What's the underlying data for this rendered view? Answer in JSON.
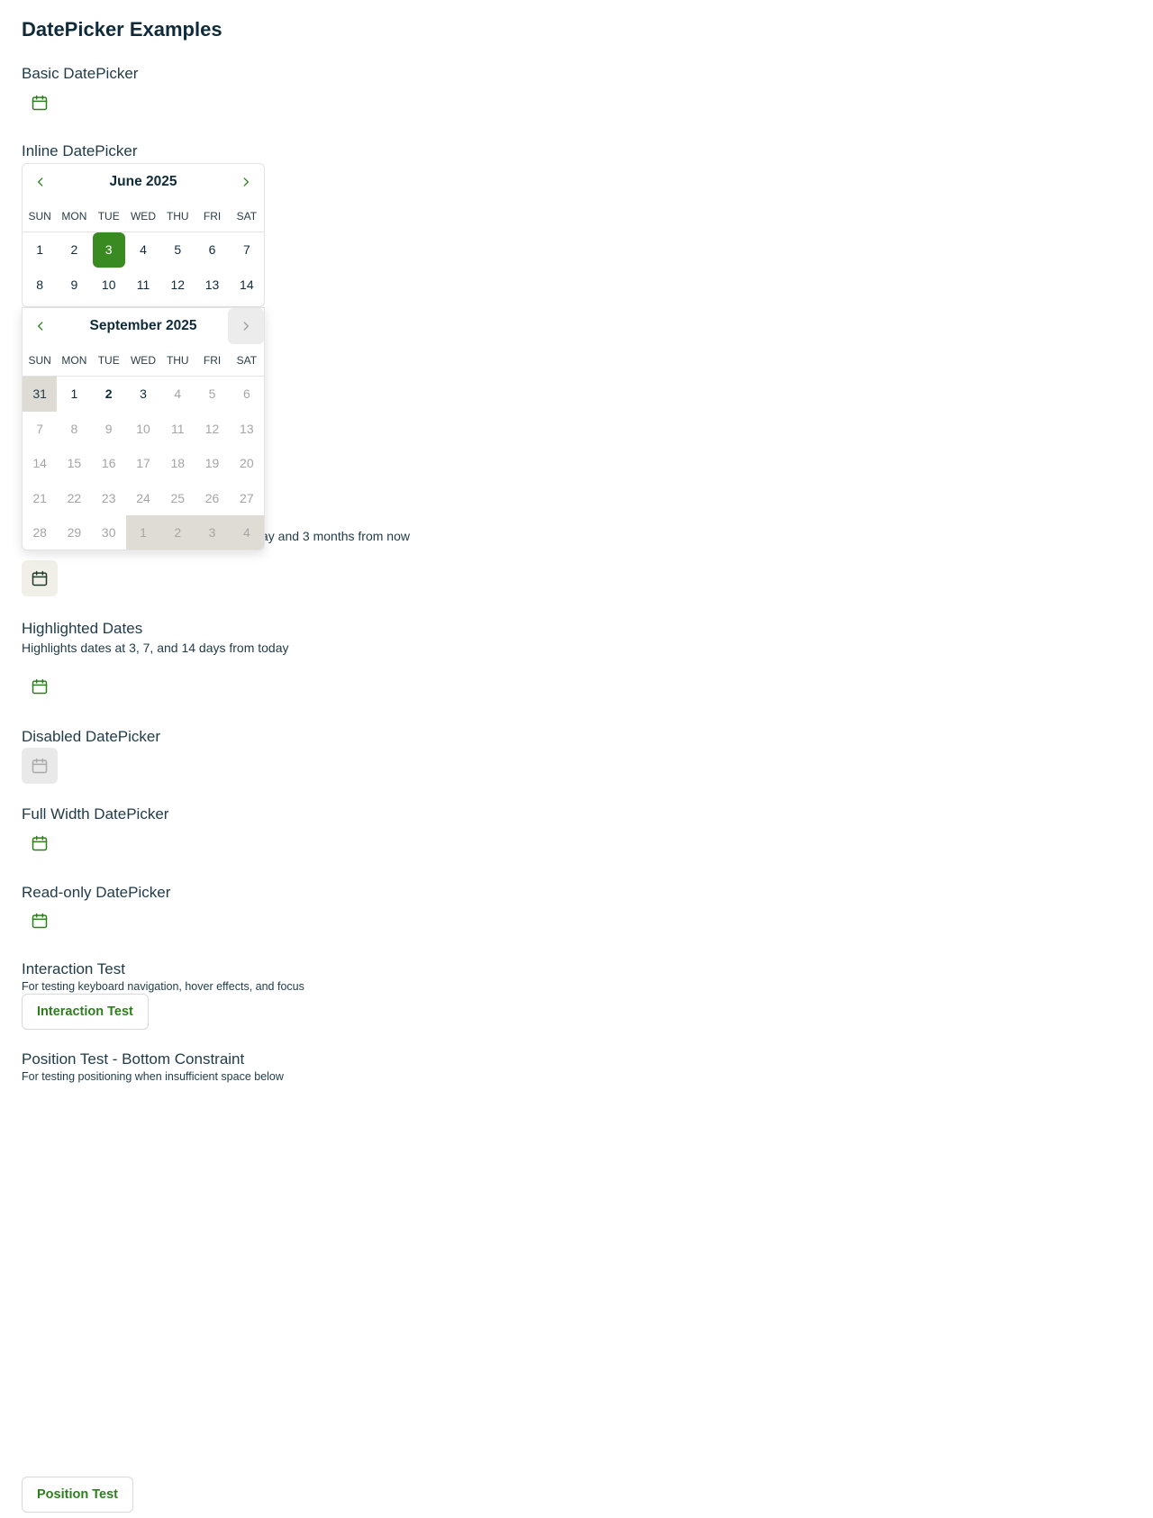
{
  "page": {
    "title": "DatePicker Examples"
  },
  "sections": {
    "basic": {
      "label": "Basic DatePicker"
    },
    "inline": {
      "label": "Inline DatePicker",
      "month": "June 2025",
      "weekdays": [
        "SUN",
        "MON",
        "TUE",
        "WED",
        "THU",
        "FRI",
        "SAT"
      ],
      "rows": [
        [
          "1",
          "2",
          "3",
          "4",
          "5",
          "6",
          "7"
        ],
        [
          "8",
          "9",
          "10",
          "11",
          "12",
          "13",
          "14"
        ]
      ],
      "selected_day": "3"
    },
    "popup": {
      "month": "September 2025",
      "weekdays": [
        "SUN",
        "MON",
        "TUE",
        "WED",
        "THU",
        "FRI",
        "SAT"
      ],
      "rows": [
        [
          "31",
          "1",
          "2",
          "3",
          "4",
          "5",
          "6"
        ],
        [
          "7",
          "8",
          "9",
          "10",
          "11",
          "12",
          "13"
        ],
        [
          "14",
          "15",
          "16",
          "17",
          "18",
          "19",
          "20"
        ],
        [
          "21",
          "22",
          "23",
          "24",
          "25",
          "26",
          "27"
        ],
        [
          "28",
          "29",
          "30",
          "1",
          "2",
          "3",
          "4"
        ]
      ]
    },
    "range": {
      "desc_visible": "ay and 3 months from now"
    },
    "highlighted": {
      "label": "Highlighted Dates",
      "desc": "Highlights dates at 3, 7, and 14 days from today"
    },
    "disabled": {
      "label": "Disabled DatePicker"
    },
    "fullwidth": {
      "label": "Full Width DatePicker"
    },
    "readonly": {
      "label": "Read-only DatePicker"
    },
    "interaction": {
      "label": "Interaction Test",
      "desc": "For testing keyboard navigation, hover effects, and focus",
      "button": "Interaction Test"
    },
    "position": {
      "label": "Position Test - Bottom Constraint",
      "desc": "For testing positioning when insufficient space below",
      "button": "Position Test"
    }
  },
  "icons": {
    "calendar": "calendar-icon",
    "prev": "chevron-left-icon",
    "next": "chevron-right-icon"
  },
  "colors": {
    "accent": "#2e7d1e",
    "selected_bg": "#3a8a22",
    "range_bg": "#dedcd4",
    "text": "#0f2b3a"
  }
}
